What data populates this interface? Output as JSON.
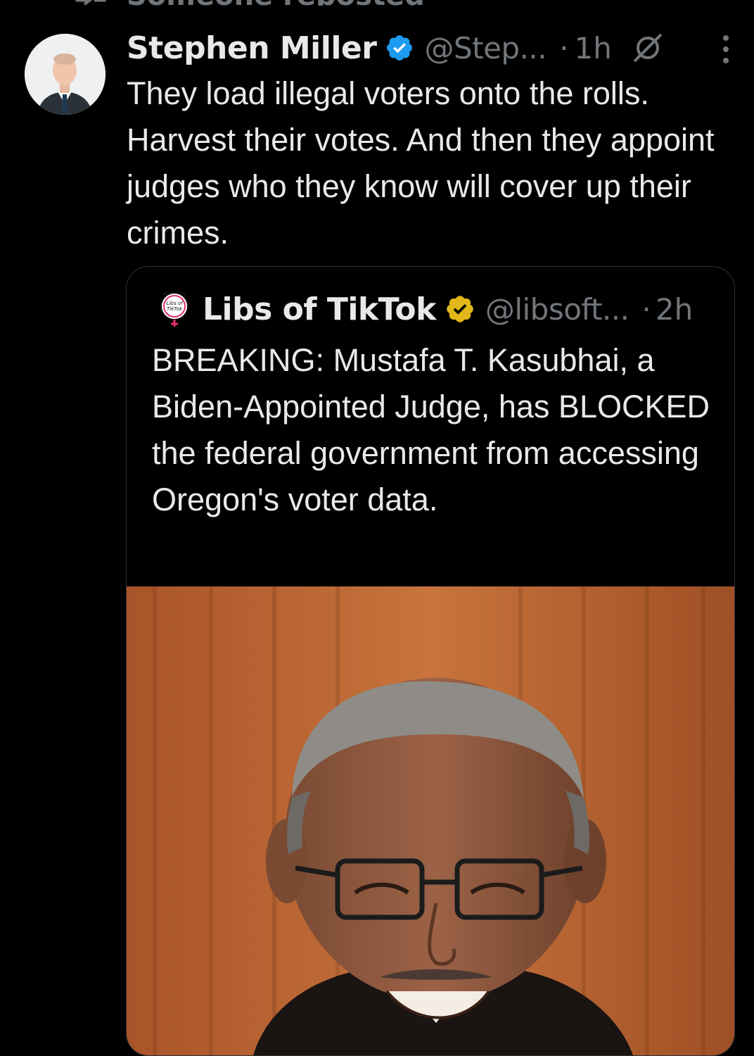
{
  "repost": {
    "label": "Someone reposted"
  },
  "tweet": {
    "author_name": "Stephen Miller",
    "handle": "@Step...",
    "separator": "·",
    "time": "1h",
    "text": "They load illegal voters onto the rolls. Harvest their votes. And then they appoint judges who they know will cover up their crimes.",
    "verified_color": "#1d9bf0"
  },
  "quote": {
    "author_name": "Libs of TikTok",
    "handle": "@libsoft...",
    "separator": "·",
    "time": "2h",
    "text": "BREAKING: Mustafa T. Kasubhai, a Biden-Appointed Judge, has BLOCKED the federal government from accessing Oregon's voter data.",
    "verified_color": "#e2b719",
    "avatar_text_line1": "Libs of",
    "avatar_text_line2": "TikTok"
  },
  "icons": {
    "repost": "repost-icon",
    "verified": "verified-badge-icon",
    "grok": "grok-icon",
    "more": "more-options-icon",
    "gold_verified": "gold-verified-badge-icon"
  }
}
